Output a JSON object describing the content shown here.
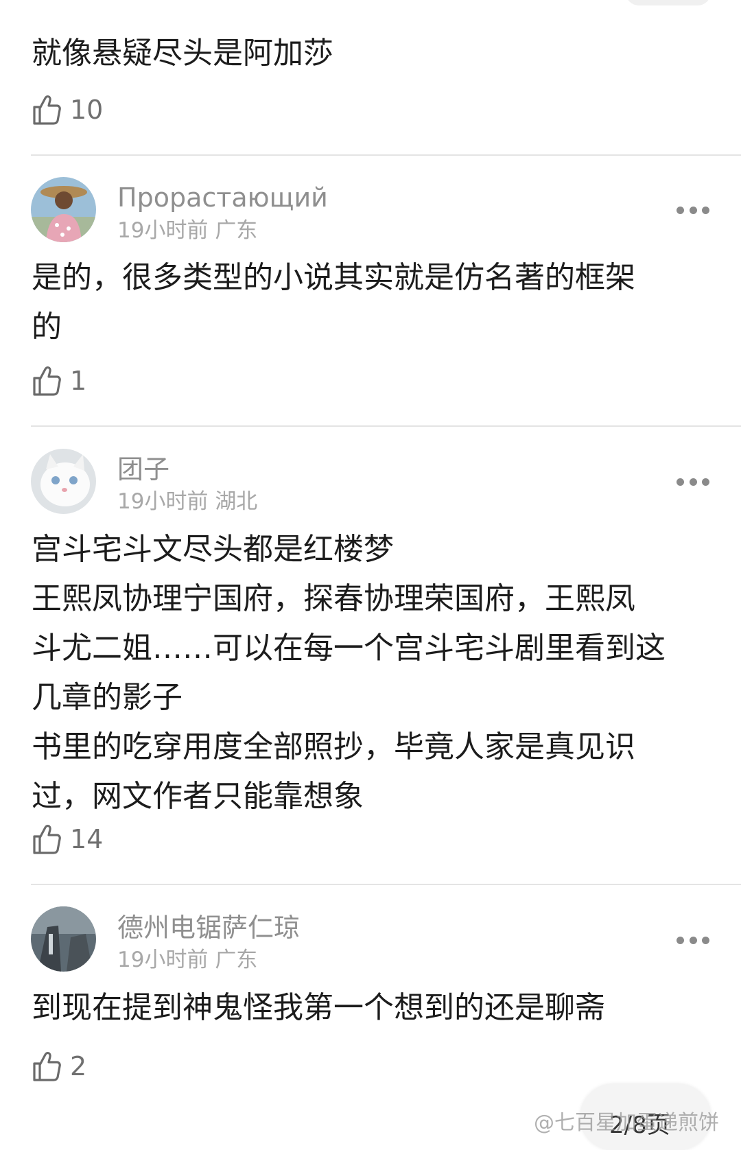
{
  "comments": [
    {
      "body_lines": [
        "就像悬疑尽头是阿加莎"
      ],
      "likes": "10"
    },
    {
      "username": "Прорастающий",
      "time": "19小时前",
      "location": "广东",
      "body_lines": [
        "是的，很多类型的小说其实就是仿名著的框架",
        "的"
      ],
      "likes": "1"
    },
    {
      "username": "团子",
      "time": "19小时前",
      "location": "湖北",
      "body_lines": [
        "宫斗宅斗文尽头都是红楼梦",
        "王熙凤协理宁国府，探春协理荣国府，王熙凤",
        "斗尤二姐……可以在每一个宫斗宅斗剧里看到这",
        "几章的影子",
        "书里的吃穿用度全部照抄，毕竟人家是真见识",
        "过，网文作者只能靠想象"
      ],
      "likes": "14"
    },
    {
      "username": "德州电锯萨仁琼",
      "time": "19小时前",
      "location": "广东",
      "body_lines": [
        "到现在提到神鬼怪我第一个想到的还是聊斋"
      ],
      "likes": "2"
    }
  ],
  "icons": {
    "like": "thumbs-up-icon",
    "more": "more-options-icon"
  },
  "page_indicator": "2/8页",
  "watermark": "@七百星加蛋递煎饼",
  "colors": {
    "username": "#8f8f8f",
    "meta": "#a8a8a8",
    "body": "#1c1c1c",
    "divider": "#e4e4e4"
  }
}
